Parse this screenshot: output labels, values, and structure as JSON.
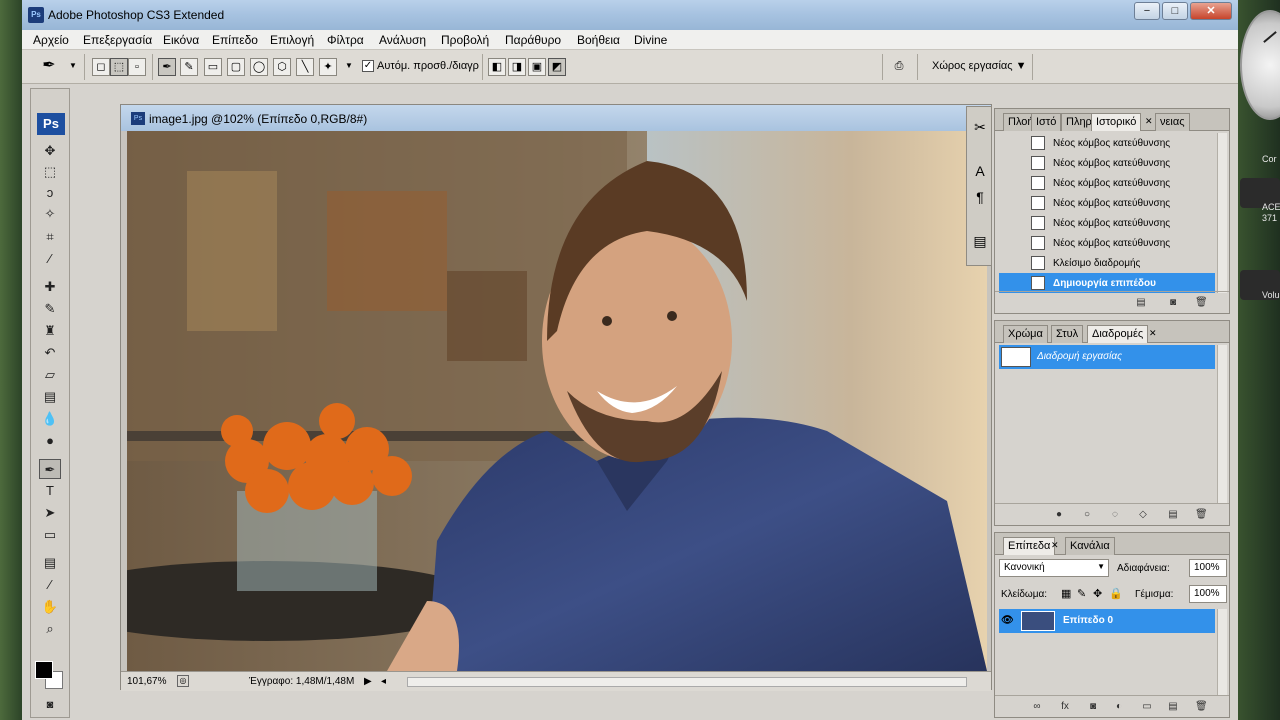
{
  "desktop": {
    "right_labels": [
      "Cor",
      "ACE",
      "371",
      "Volu"
    ]
  },
  "window": {
    "title": "Adobe Photoshop CS3 Extended",
    "minimize_label": "−",
    "maximize_label": "□",
    "close_label": "✕"
  },
  "menu": [
    "Αρχείο",
    "Επεξεργασία",
    "Εικόνα",
    "Επίπεδο",
    "Επιλογή",
    "Φίλτρα",
    "Ανάλυση",
    "Προβολή",
    "Παράθυρο",
    "Βοήθεια",
    "Divine"
  ],
  "options": {
    "auto_add_label": "Αυτόμ. προσθ./διαγρ",
    "auto_add_checked": "✓",
    "workspace_label": "Χώρος εργασίας ▼"
  },
  "document": {
    "title": "image1.jpg @102% (Επίπεδο 0,RGB/8#)",
    "zoom": "101,67%",
    "doc_info": "Έγγραφο: 1,48M/1,48M",
    "nav_arrow": "▶"
  },
  "history_panel": {
    "tabs": [
      "Πλοή",
      "Ιστό",
      "Πληρ",
      "Ιστορικό",
      "νειας"
    ],
    "close": "✕",
    "items": [
      {
        "label": "Νέος κόμβος κατεύθυνσης"
      },
      {
        "label": "Νέος κόμβος κατεύθυνσης"
      },
      {
        "label": "Νέος κόμβος κατεύθυνσης"
      },
      {
        "label": "Νέος κόμβος κατεύθυνσης"
      },
      {
        "label": "Νέος κόμβος κατεύθυνσης"
      },
      {
        "label": "Νέος κόμβος κατεύθυνσης"
      },
      {
        "label": "Κλείσιμο διαδρομής"
      },
      {
        "label": "Δημιουργία επιπέδου"
      }
    ]
  },
  "paths_panel": {
    "tabs": [
      "Χρώμα",
      "Στυλ",
      "Διαδρομές"
    ],
    "close": "✕",
    "selected_path": "Διαδρομή εργασίας"
  },
  "layers_panel": {
    "tabs": [
      "Επίπεδα",
      "Κανάλια"
    ],
    "close": "✕",
    "blend_mode": "Κανονική",
    "opacity_label": "Αδιαφάνεια:",
    "opacity_value": "100%",
    "lock_label": "Κλείδωμα:",
    "fill_label": "Γέμισμα:",
    "fill_value": "100%",
    "layer_name": "Επίπεδο 0"
  },
  "colors": {
    "selection": "#3391ea",
    "ps_blue": "#1d4fa0"
  }
}
